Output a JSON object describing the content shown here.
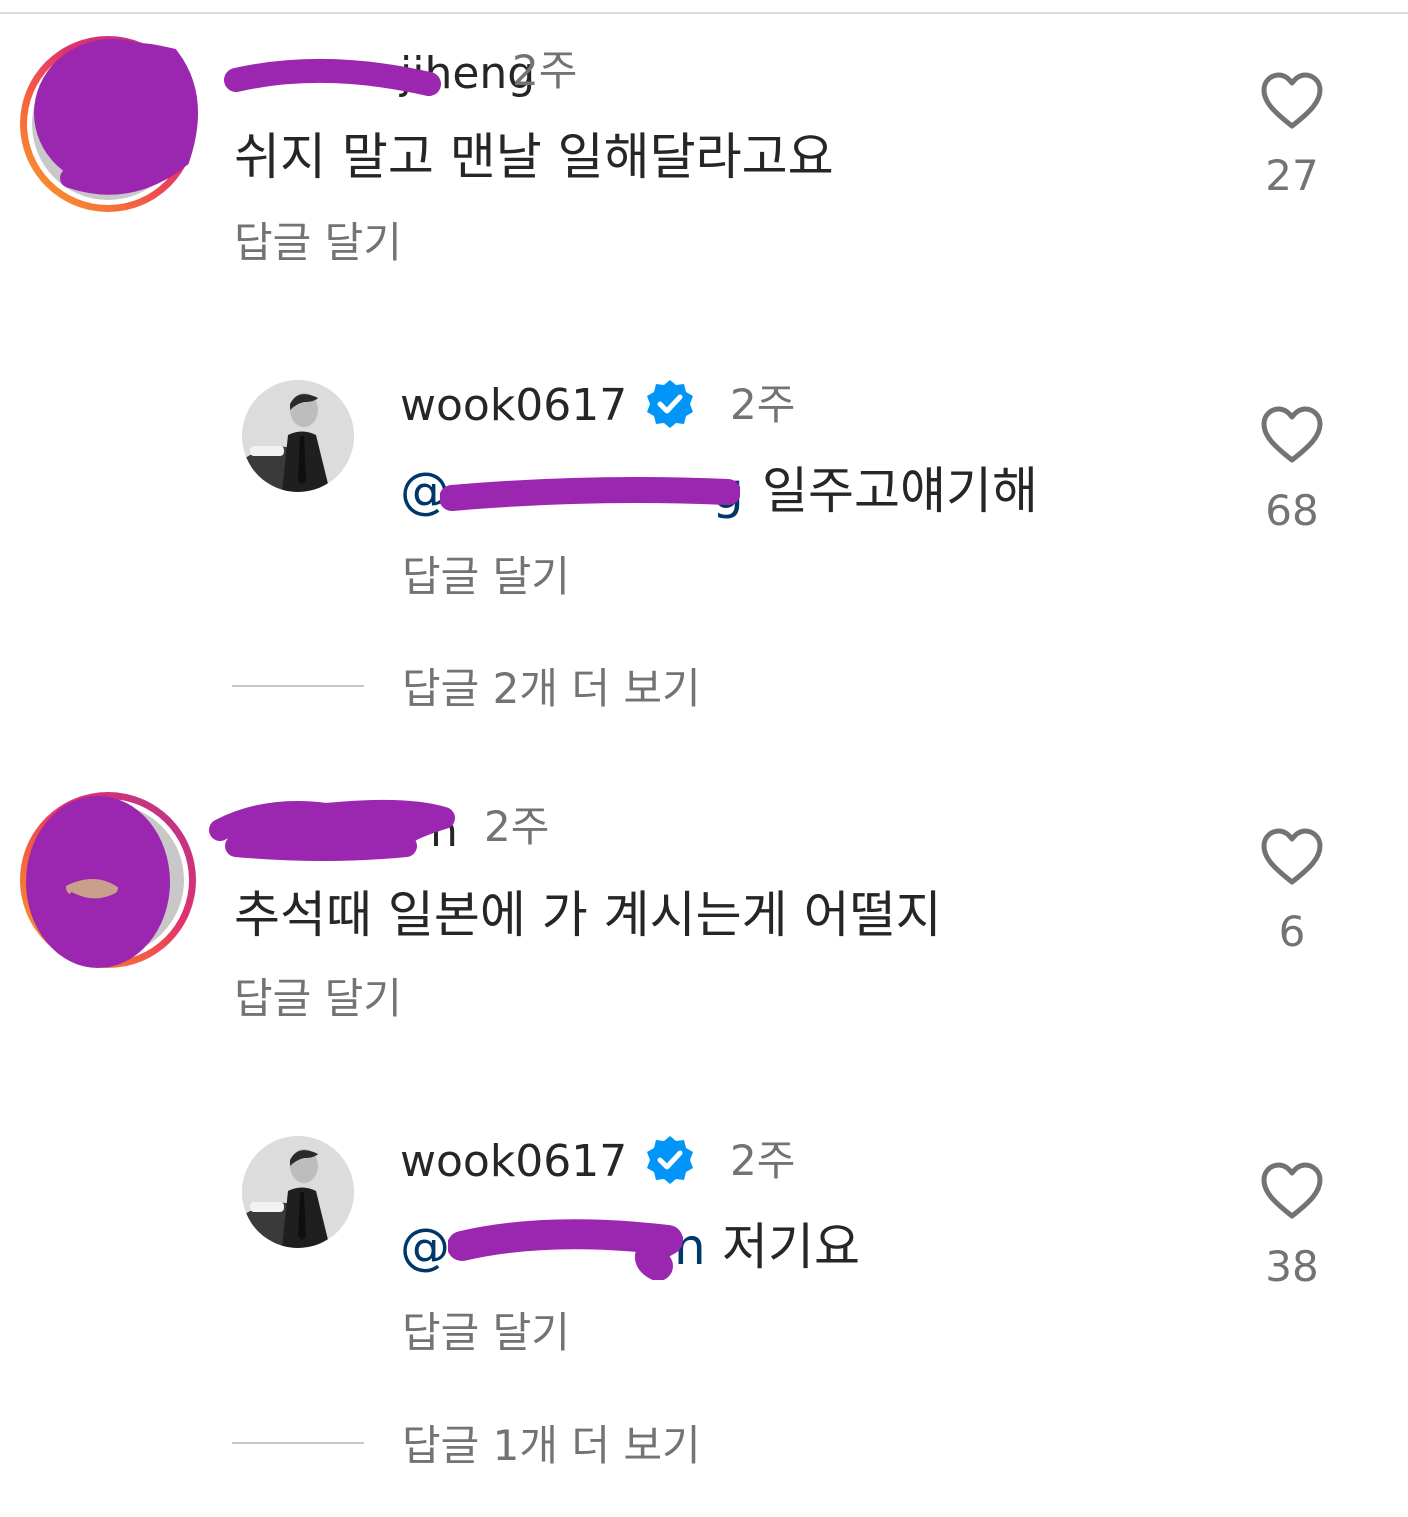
{
  "comments": [
    {
      "username_visible_suffix": "jiheng",
      "time": "2주",
      "text": "쉬지 말고 맨날 일해달라고요",
      "reply_label": "답글 달기",
      "likes": "27",
      "reply": {
        "username": "wook0617",
        "time": "2주",
        "mention_visible": "@",
        "mention_suffix": "g",
        "text": "일주고얘기해",
        "reply_label": "답글 달기",
        "likes": "68"
      },
      "more_replies": "답글 2개 더 보기"
    },
    {
      "username_visible_suffix": "n",
      "time": "2주",
      "text": "추석때 일본에 가 계시는게 어떨지",
      "reply_label": "답글 달기",
      "likes": "6",
      "reply": {
        "username": "wook0617",
        "time": "2주",
        "mention_visible": "@",
        "mention_suffix": "n",
        "text": "저기요",
        "reply_label": "답글 달기",
        "likes": "38"
      },
      "more_replies": "답글 1개 더 보기"
    }
  ],
  "colors": {
    "redaction": "#9b27b0",
    "mention": "#00376b",
    "verified": "#0095f6",
    "secondary_text": "#737373"
  }
}
